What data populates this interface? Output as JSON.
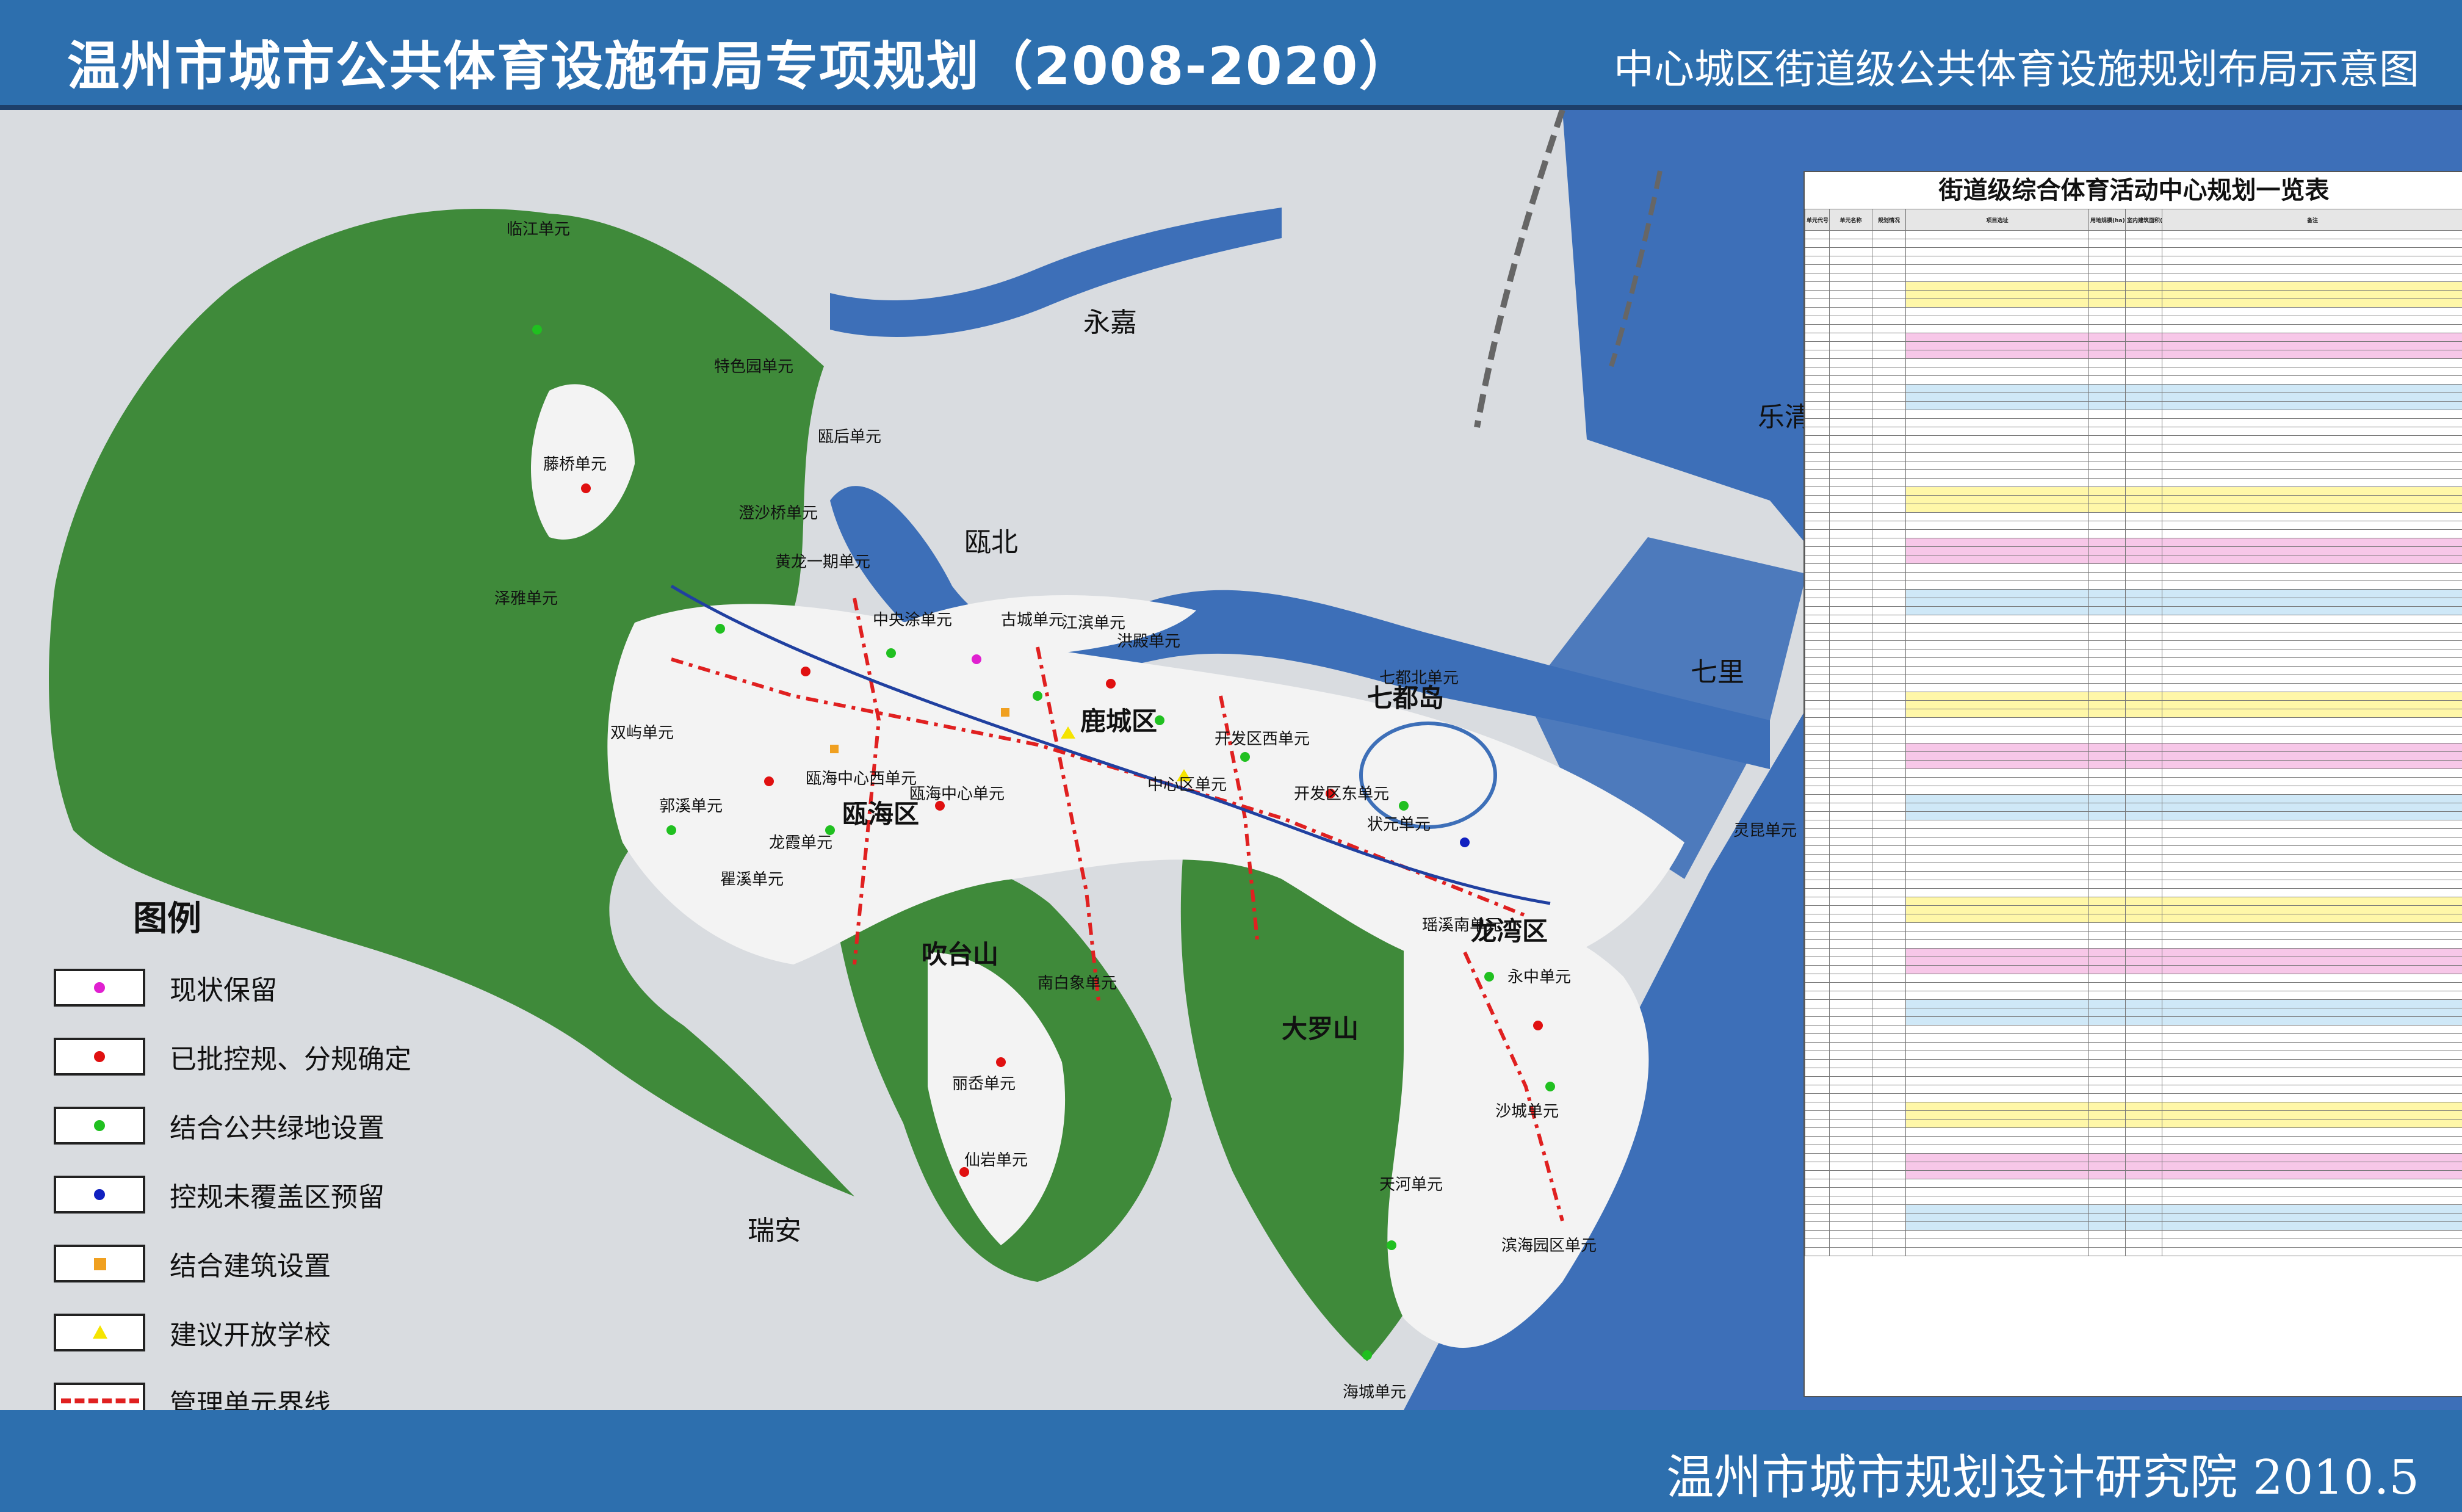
{
  "header": {
    "title": "温州市城市公共体育设施布局专项规划（2008-2020）",
    "subtitle": "中心城区街道级公共体育设施规划布局示意图"
  },
  "footer": {
    "org": "温州市城市规划设计研究院 2010.5"
  },
  "legend": {
    "title": "图例",
    "items": [
      {
        "label": "现状保留",
        "color": "#e020d0",
        "symbol": "dot"
      },
      {
        "label": "已批控规、分规确定",
        "color": "#e01010",
        "symbol": "dot"
      },
      {
        "label": "结合公共绿地设置",
        "color": "#20c020",
        "symbol": "dot"
      },
      {
        "label": "控规未覆盖区预留",
        "color": "#1020c0",
        "symbol": "dot"
      },
      {
        "label": "结合建筑设置",
        "color": "#f0a020",
        "symbol": "square"
      },
      {
        "label": "建议开放学校",
        "color": "#f5e400",
        "symbol": "triangle"
      },
      {
        "label": "管理单元界线",
        "color": "#e02020",
        "symbol": "dashed-line"
      }
    ]
  },
  "table": {
    "title": "街道级综合体育活动中心规划一览表",
    "headers": [
      "单元代号",
      "单元名称",
      "规划情况",
      "项目选址",
      "用地规模(ha)",
      "室内建筑面积(㎡)",
      "备注"
    ],
    "row_count": 120
  },
  "map": {
    "colors": {
      "sea": "#3d6fb8",
      "river": "#3d6fb8",
      "green": "#3f8a3a",
      "urban": "#f3f3f3",
      "terrain": "#d5d8dc"
    },
    "big_places": [
      {
        "id": "yongjia",
        "text": "永嘉"
      },
      {
        "id": "leqing",
        "text": "乐清"
      },
      {
        "id": "qili",
        "text": "七里"
      },
      {
        "id": "ruian",
        "text": "瑞安"
      },
      {
        "id": "oubei",
        "text": "瓯北"
      }
    ],
    "districts": [
      {
        "id": "lucheng",
        "text": "鹿城区"
      },
      {
        "id": "ouhai",
        "text": "瓯海区"
      },
      {
        "id": "longwan",
        "text": "龙湾区"
      },
      {
        "id": "qidudao",
        "text": "七都岛"
      },
      {
        "id": "chuitaishan",
        "text": "吹台山"
      },
      {
        "id": "daluoshan",
        "text": "大罗山"
      }
    ],
    "units": [
      {
        "id": "linjiang",
        "text": "临江单元"
      },
      {
        "id": "tesechengyuan",
        "text": "特色园单元"
      },
      {
        "id": "tengqiao",
        "text": "藤桥单元"
      },
      {
        "id": "ouwanshan",
        "text": "瓯后单元"
      },
      {
        "id": "chengsha",
        "text": "澄沙桥单元"
      },
      {
        "id": "zeya",
        "text": "泽雅单元"
      },
      {
        "id": "huanglong",
        "text": "黄龙一期单元"
      },
      {
        "id": "zhongyangtu",
        "text": "中央涂单元"
      },
      {
        "id": "guchengdanyuan",
        "text": "古城单元"
      },
      {
        "id": "jiangbin",
        "text": "江滨单元"
      },
      {
        "id": "hongdian",
        "text": "洪殿单元"
      },
      {
        "id": "shuangyu",
        "text": "双屿单元"
      },
      {
        "id": "ouhaizhongxinxi",
        "text": "瓯海中心西单元"
      },
      {
        "id": "ouhaizhongxin",
        "text": "瓯海中心单元"
      },
      {
        "id": "lucheng_zhongxin",
        "text": "中心区单元"
      },
      {
        "id": "kaifaquxi",
        "text": "开发区西单元"
      },
      {
        "id": "kaifaqudong",
        "text": "开发区东单元"
      },
      {
        "id": "zhuangyuan",
        "text": "状元单元"
      },
      {
        "id": "yongzhong",
        "text": "永中单元"
      },
      {
        "id": "haibin",
        "text": "海城单元"
      },
      {
        "id": "tianhe",
        "text": "天河单元"
      },
      {
        "id": "shacheng",
        "text": "沙城单元"
      },
      {
        "id": "binhaiyuan",
        "text": "滨海园区单元"
      },
      {
        "id": "xianyan",
        "text": "仙岩单元"
      },
      {
        "id": "lishui",
        "text": "丽岙单元"
      },
      {
        "id": "nanbai",
        "text": "南白象单元"
      },
      {
        "id": "guoxi",
        "text": "郭溪单元"
      },
      {
        "id": "qutang",
        "text": "瞿溪单元"
      },
      {
        "id": "longxia",
        "text": "龙霞单元"
      },
      {
        "id": "yaoxi",
        "text": "瑶溪南单元"
      },
      {
        "id": "lingkun",
        "text": "灵昆单元"
      },
      {
        "id": "qiducbei",
        "text": "七都北单元"
      }
    ]
  }
}
